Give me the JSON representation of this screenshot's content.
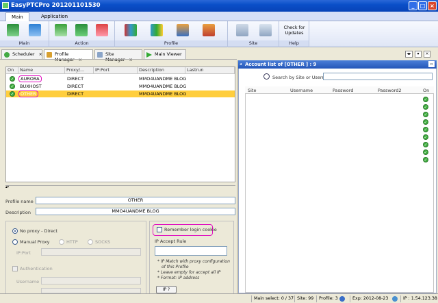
{
  "window": {
    "title": "EasyPTCPro 201201101530"
  },
  "ribbon": {
    "tabs": [
      {
        "label": "Main"
      },
      {
        "label": "Application"
      }
    ],
    "groups": {
      "main": "Main",
      "action": "Action",
      "profile": "Profile",
      "site": "Site",
      "help": "Help"
    },
    "check_updates": "Check for Updates"
  },
  "doc_tabs": [
    {
      "label": "Scheduler"
    },
    {
      "label": "Profile Manager"
    },
    {
      "label": "Site Manager"
    },
    {
      "label": "Main Viewer"
    }
  ],
  "profile_grid": {
    "columns": [
      "On",
      "Name",
      "Proxy/...",
      "IP:Port",
      "Description",
      "Lastrun"
    ],
    "rows": [
      {
        "name": "AURORA",
        "proxy": "DIRECT",
        "description": "MMO4UANDME BLOG"
      },
      {
        "name": "BUXHOST",
        "proxy": "DIRECT",
        "description": "MMO4UANDME BLOG"
      },
      {
        "name": "OTHER",
        "proxy": "DIRECT",
        "description": "MMO4UANDME BLOG"
      }
    ]
  },
  "profile_form": {
    "profile_name_label": "Profile name",
    "profile_name_value": "OTHER",
    "description_label": "Description",
    "description_value": "MMO4UANDME BLOG",
    "no_proxy_label": "No proxy - Direct",
    "manual_proxy_label": "Manual Proxy",
    "http_label": "HTTP",
    "socks_label": "SOCKS",
    "ip_port_label": "IP:Port",
    "authentication_label": "Authentication",
    "username_label": "Username",
    "remember_cookie_label": "Remember login cookie",
    "ip_accept_rule_label": "IP Accept Rule",
    "notes": [
      "* IP Match with proxy configuration",
      "of this Profile",
      "* Leave empty for accept all IP",
      "* Format: IP address"
    ],
    "ip_button_label": "IP ?"
  },
  "account_list": {
    "header": "Account list of [OTHER ] : 9",
    "search_placeholder": "Search by Site or Username",
    "columns": [
      "Site",
      "Username",
      "Password",
      "Password2",
      "On"
    ],
    "on_count": 9
  },
  "statusbar": {
    "main_select": "Main select: 0 / 37",
    "site": "Site: 99",
    "profile": "Profile: 3",
    "exp": "Exp: 2012-08-23",
    "ip": "IP : 1.54.123.38"
  }
}
